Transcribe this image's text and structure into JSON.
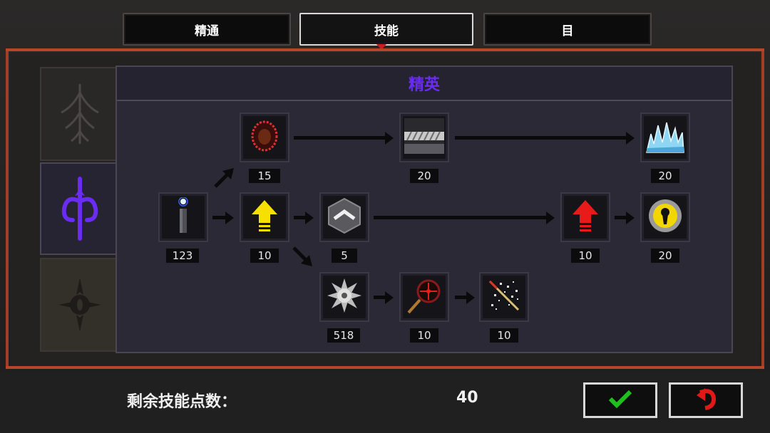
{
  "tabs": [
    {
      "label": "精通",
      "active": false
    },
    {
      "label": "技能",
      "active": true
    },
    {
      "label": "目",
      "active": false
    }
  ],
  "tree": {
    "title": "精英",
    "title_color": "#6a2cf0",
    "nodes": [
      {
        "id": "eye-frenzy",
        "icon": "red-aura-icon",
        "count": "15"
      },
      {
        "id": "chain",
        "icon": "chain-icon",
        "count": "20"
      },
      {
        "id": "ice-spikes",
        "icon": "ice-spikes-icon",
        "count": "20"
      },
      {
        "id": "candle",
        "icon": "candle-icon",
        "count": "123"
      },
      {
        "id": "yellow-up",
        "icon": "yellow-up-arrow-icon",
        "count": "10"
      },
      {
        "id": "chevron",
        "icon": "chevron-shield-icon",
        "count": "5"
      },
      {
        "id": "red-up",
        "icon": "red-up-arrow-icon",
        "count": "10"
      },
      {
        "id": "gold-lock",
        "icon": "keyhole-icon",
        "count": "20"
      },
      {
        "id": "star-mine",
        "icon": "spiked-mine-icon",
        "count": "518"
      },
      {
        "id": "crosshair",
        "icon": "crosshair-magnifier-icon",
        "count": "10"
      },
      {
        "id": "sparkle-wand",
        "icon": "sparkle-wand-icon",
        "count": "10"
      }
    ]
  },
  "categories": [
    {
      "icon": "spiky-tree-icon",
      "selected": false
    },
    {
      "icon": "trident-rune-icon",
      "selected": true,
      "color": "#6a2cf0"
    },
    {
      "icon": "sun-eye-icon",
      "selected": false
    }
  ],
  "bottom": {
    "remaining_label": "剩余技能点数：",
    "remaining_value": "40",
    "confirm_icon": "green-check-icon",
    "reset_icon": "red-undo-icon"
  }
}
